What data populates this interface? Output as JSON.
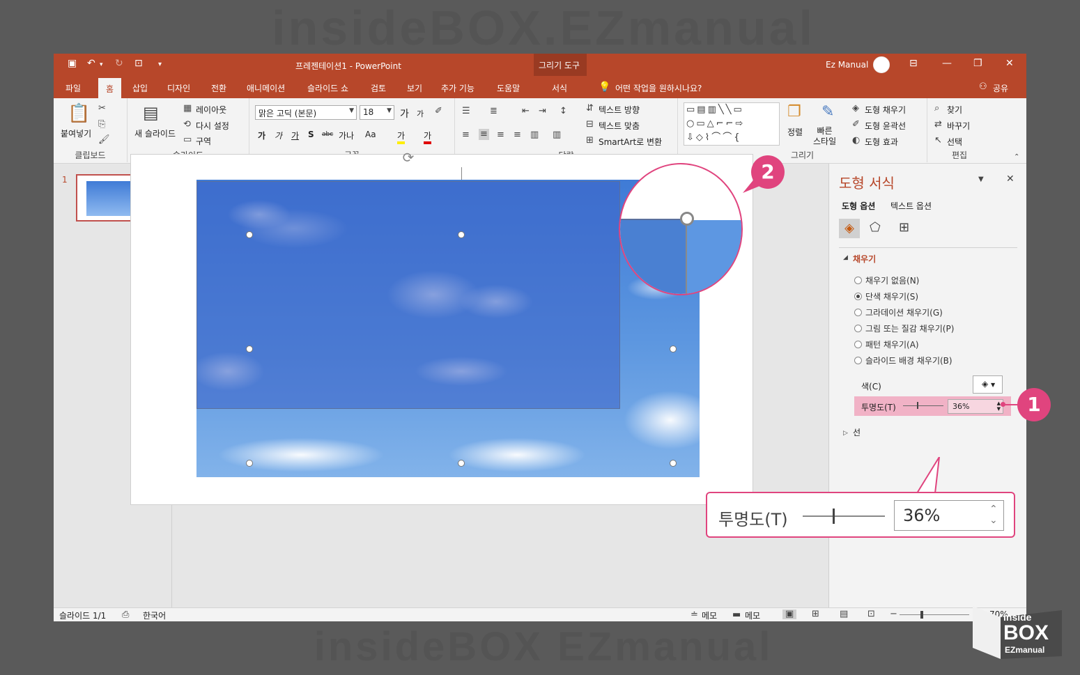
{
  "watermark": {
    "top": "insideBOX.EZmanual",
    "bottom": "insideBOX EZmanual"
  },
  "titlebar": {
    "quick_access": {
      "save": "save-icon",
      "undo": "undo-icon",
      "redo": "redo-icon",
      "present": "present-icon",
      "customize": "▾"
    },
    "title": "프레젠테이션1  -  PowerPoint",
    "context_group": "그리기 도구",
    "user": "Ez Manual",
    "controls": {
      "ribbon_display": "ribbon-display-icon",
      "minimize": "—",
      "restore": "❐",
      "close": "✕"
    }
  },
  "tabs": [
    {
      "label": "파일"
    },
    {
      "label": "홈"
    },
    {
      "label": "삽입"
    },
    {
      "label": "디자인"
    },
    {
      "label": "전환"
    },
    {
      "label": "애니메이션"
    },
    {
      "label": "슬라이드 쇼"
    },
    {
      "label": "검토"
    },
    {
      "label": "보기"
    },
    {
      "label": "추가 기능"
    },
    {
      "label": "도움말"
    },
    {
      "label": "서식"
    }
  ],
  "tellme": "어떤 작업을 원하시나요?",
  "share": "공유",
  "ribbon": {
    "clipboard": {
      "label": "클립보드",
      "paste": "붙여넣기"
    },
    "slides": {
      "label": "슬라이드",
      "new_slide": "새 슬라이드",
      "layout": "레이아웃",
      "reset": "다시 설정",
      "section": "구역"
    },
    "font": {
      "label": "글꼴",
      "font_name": "맑은 고딕 (본문)",
      "font_size": "18",
      "grow": "가",
      "shrink": "가",
      "bold": "가",
      "italic": "가",
      "underline": "가",
      "shadow": "S",
      "strike": "abc",
      "spacing": "가나",
      "case": "Aa",
      "highlight": "가",
      "color": "가"
    },
    "paragraph": {
      "label": "단락",
      "text_direction": "텍스트 방향",
      "align_text": "텍스트 맞춤",
      "smartart": "SmartArt로 변환"
    },
    "drawing": {
      "label": "그리기",
      "arrange": "정렬",
      "quick_styles": "빠른\n스타일",
      "shape_fill": "도형 채우기",
      "shape_outline": "도형 윤곽선",
      "shape_effects": "도형 효과"
    },
    "editing": {
      "label": "편집",
      "find": "찾기",
      "replace": "바꾸기",
      "select": "선택"
    }
  },
  "thumbnails": [
    {
      "number": "1"
    }
  ],
  "format_pane": {
    "title": "도형 서식",
    "tabs": [
      "도형 옵션",
      "텍스트 옵션"
    ],
    "section_fill": "채우기",
    "fill_options": [
      {
        "label": "채우기 없음(N)",
        "selected": false
      },
      {
        "label": "단색 채우기(S)",
        "selected": true
      },
      {
        "label": "그라데이션 채우기(G)",
        "selected": false
      },
      {
        "label": "그림 또는 질감 채우기(P)",
        "selected": false
      },
      {
        "label": "패턴 채우기(A)",
        "selected": false
      },
      {
        "label": "슬라이드 배경 채우기(B)",
        "selected": false
      }
    ],
    "color_label": "색(C)",
    "transparency_label": "투명도(T)",
    "transparency_value": "36%",
    "transparency_level": 0.36,
    "section_line": "선"
  },
  "callouts": {
    "one": "1",
    "two": "2"
  },
  "zoom_callout": {
    "label": "투명도(T)",
    "value": "36%"
  },
  "statusbar": {
    "slide": "슬라이드 1/1",
    "language": "한국어",
    "notes": "메모",
    "comments": "메모",
    "zoom": "70%"
  },
  "logo": {
    "text_top": "inside",
    "text_mid": "BOX",
    "text_bottom": "EZmanual"
  },
  "colors": {
    "accent": "#b7472a",
    "highlight": "#e0447e"
  }
}
